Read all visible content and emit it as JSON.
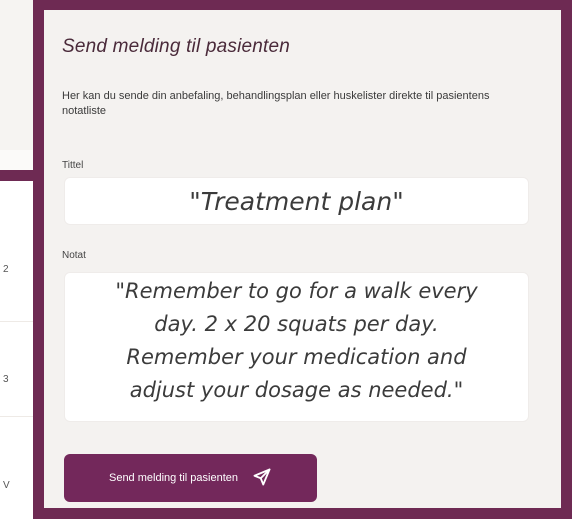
{
  "background": {
    "row_numbers": [
      "2",
      "3",
      "V"
    ]
  },
  "modal": {
    "title": "Send melding til pasienten",
    "description": "Her kan du sende din anbefaling, behandlingsplan eller huskelister direkte til pasientens notatliste",
    "title_label": "Tittel",
    "title_value": "\"Treatment plan\"",
    "note_label": "Notat",
    "note_lines": [
      "\"Remember to go for a walk every",
      "day. 2 x 20 squats per day.",
      "Remember your medication and",
      "adjust your dosage as needed.\""
    ],
    "send_button_label": "Send melding til pasienten",
    "send_icon": "paper-plane-icon"
  },
  "colors": {
    "accent": "#6e2a53",
    "button": "#73285b",
    "panel_bg": "#f4f2f0"
  }
}
